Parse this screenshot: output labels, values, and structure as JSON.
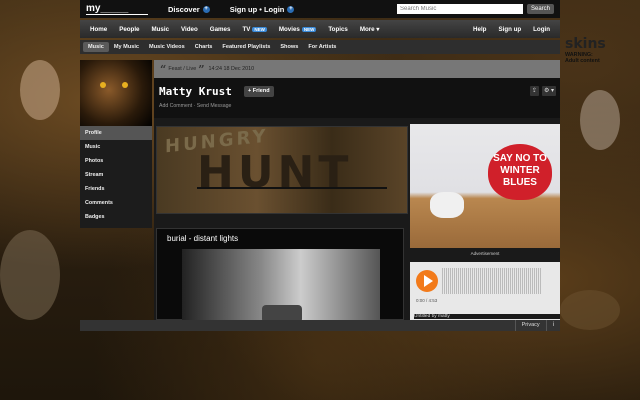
{
  "topbar": {
    "logo": "my_____",
    "discover": "Discover",
    "signup_login": "Sign up • Login",
    "search_placeholder": "Search Music",
    "search_button": "Search"
  },
  "nav": {
    "items": [
      "Home",
      "People",
      "Music",
      "Video",
      "Games",
      "TV",
      "Movies",
      "Topics",
      "More ▾"
    ],
    "tv_badge": "NEW",
    "movies_badge": "NEW",
    "right": [
      "Help",
      "Sign up",
      "Login"
    ]
  },
  "subnav": {
    "items": [
      "Music",
      "My Music",
      "Music Videos",
      "Charts",
      "Featured Playlists",
      "Shows",
      "For Artists"
    ]
  },
  "sidebar": {
    "items": [
      "Profile",
      "Music",
      "Photos",
      "Stream",
      "Friends",
      "Comments",
      "Badges"
    ]
  },
  "status": {
    "text": "Feast / Live",
    "time": "14:24 18 Dec 2010"
  },
  "profile": {
    "name": "Matty Krust",
    "friend_button": "Friend",
    "actions": "Add Comment · Send Message"
  },
  "banner": {
    "word1": "HUNGRY",
    "word2": "HUNT"
  },
  "ad": {
    "line1": "SAY NO TO",
    "line2": "WINTER",
    "line3": "BLUES",
    "label": "Advertisement"
  },
  "video": {
    "title": "burial - distant lights"
  },
  "audio": {
    "time": "0:00 / 4:53",
    "caption": "Untitled by matty"
  },
  "footer": {
    "privacy": "Privacy",
    "info": "i"
  },
  "skins": {
    "brand": "skins",
    "warning1": "WARNING:",
    "warning2": "Adult content"
  }
}
